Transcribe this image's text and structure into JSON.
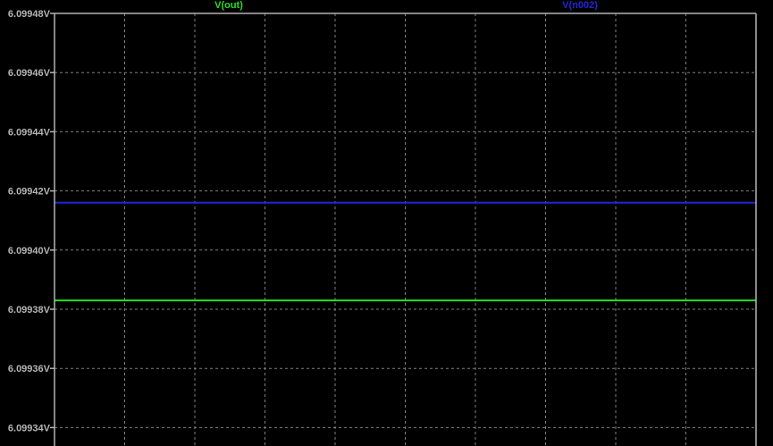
{
  "chart_data": {
    "type": "line",
    "title": "",
    "xlabel": "",
    "ylabel": "",
    "grid": true,
    "background": "#000000",
    "axis_color": "#b4b4b4",
    "grid_color": "#808080",
    "ylim": [
      6.099335,
      6.09948
    ],
    "yticks": [
      {
        "value": 6.09948,
        "label": "6.09948V"
      },
      {
        "value": 6.09946,
        "label": "6.09946V"
      },
      {
        "value": 6.09944,
        "label": "6.09944V"
      },
      {
        "value": 6.09942,
        "label": "6.09942V"
      },
      {
        "value": 6.0994,
        "label": "6.09940V"
      },
      {
        "value": 6.09938,
        "label": "6.09938V"
      },
      {
        "value": 6.09936,
        "label": "6.09936V"
      },
      {
        "value": 6.09934,
        "label": "6.09934V"
      }
    ],
    "series": [
      {
        "name": "V(out)",
        "color": "#22e01f",
        "values": [
          6.099383,
          6.099383
        ]
      },
      {
        "name": "V(n002)",
        "color": "#2424d8",
        "values": [
          6.099416,
          6.099416
        ]
      }
    ]
  }
}
